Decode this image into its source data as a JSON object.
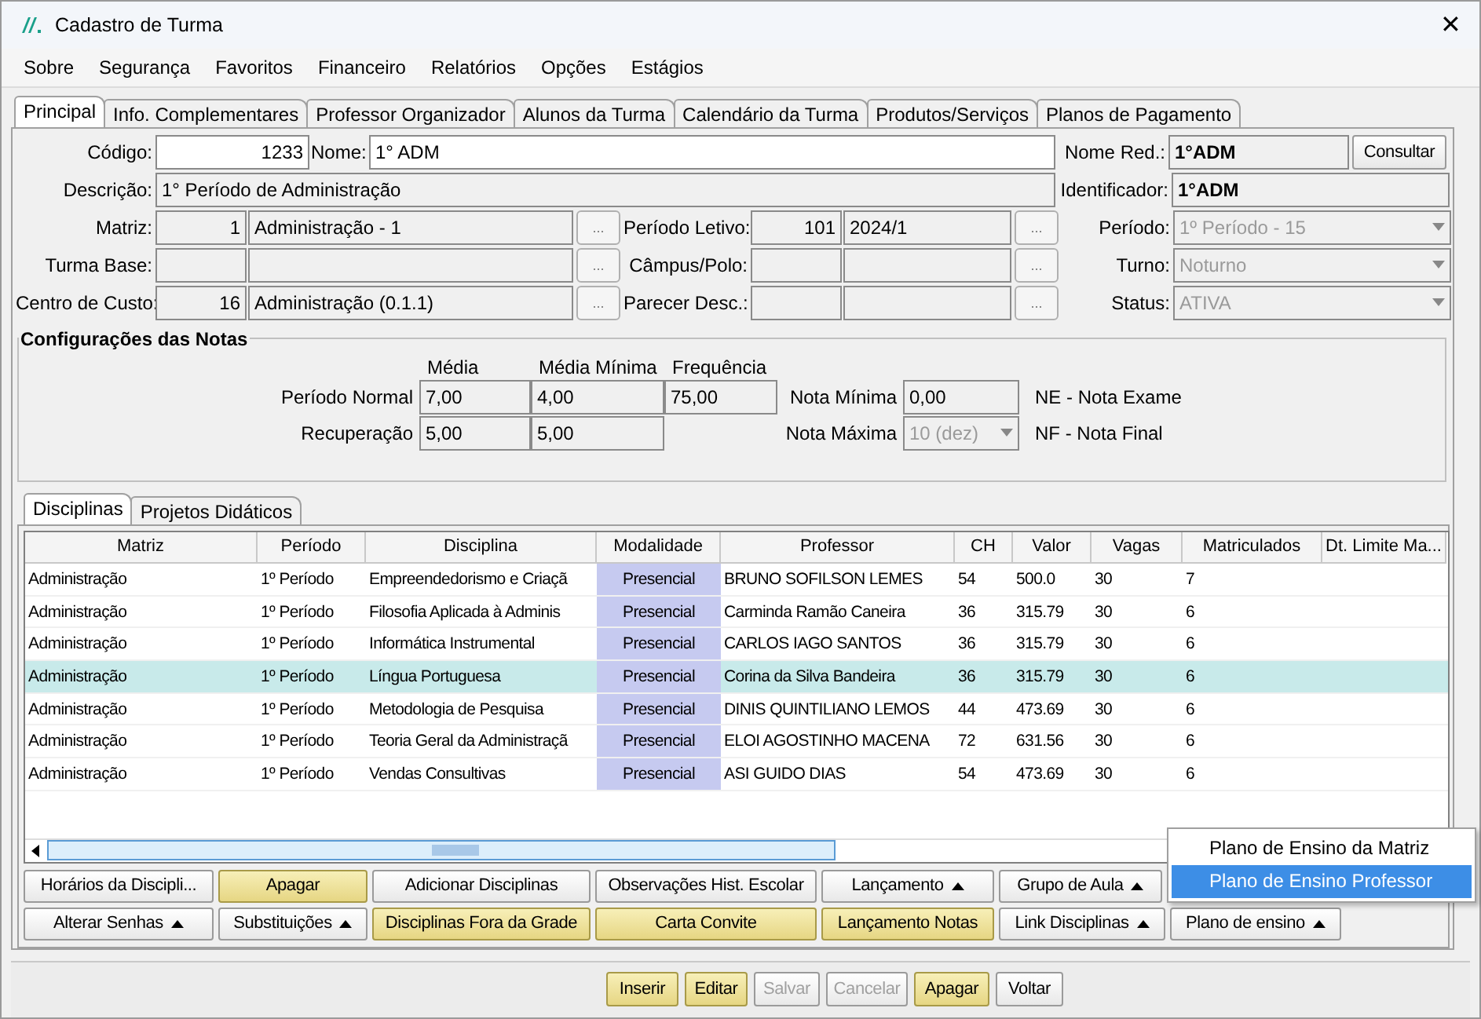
{
  "window": {
    "title": "Cadastro de Turma",
    "close": "✕"
  },
  "menu": [
    "Sobre",
    "Segurança",
    "Favoritos",
    "Financeiro",
    "Relatórios",
    "Opções",
    "Estágios"
  ],
  "tabs": [
    {
      "label": "Principal",
      "selected": true
    },
    {
      "label": "Info. Complementares",
      "selected": false
    },
    {
      "label": "Professor Organizador",
      "selected": false
    },
    {
      "label": "Alunos da Turma",
      "selected": false
    },
    {
      "label": "Calendário da Turma",
      "selected": false
    },
    {
      "label": "Produtos/Serviços",
      "selected": false
    },
    {
      "label": "Planos de Pagamento",
      "selected": false
    }
  ],
  "form": {
    "codigo": {
      "label": "Código:",
      "value": "1233"
    },
    "nome": {
      "label": "Nome:",
      "value": "1° ADM"
    },
    "nome_red": {
      "label": "Nome Red.:",
      "value": "1°ADM"
    },
    "consultar": "Consultar",
    "descricao": {
      "label": "Descrição:",
      "value": "1° Período de Administração"
    },
    "identificador": {
      "label": "Identificador:",
      "value": "1°ADM"
    },
    "matriz": {
      "label": "Matriz:",
      "code": "1",
      "name": "Administração - 1",
      "button": "..."
    },
    "periodo_letivo": {
      "label": "Período Letivo:",
      "code": "101",
      "name": "2024/1",
      "button": "..."
    },
    "periodo": {
      "label": "Período:",
      "value": "1º Período - 15",
      "disabled": true
    },
    "turma_base": {
      "label": "Turma Base:",
      "button": "..."
    },
    "campus_polo": {
      "label": "Câmpus/Polo:",
      "button": "..."
    },
    "turno": {
      "label": "Turno:",
      "value": "Noturno",
      "disabled": true
    },
    "centro_custo": {
      "label": "Centro de Custo:",
      "code": "16",
      "name": "Administração (0.1.1)",
      "button": "..."
    },
    "parecer_desc": {
      "label": "Parecer Desc.:",
      "button": "..."
    },
    "status": {
      "label": "Status:",
      "value": "ATIVA",
      "disabled": true
    }
  },
  "notas": {
    "title": "Configurações das Notas",
    "headers": [
      "Média",
      "Média Mínima",
      "Frequência"
    ],
    "rows": [
      {
        "label": "Período Normal",
        "values": [
          "7,00",
          "4,00",
          "75,00"
        ],
        "extra_label": "Nota Mínima",
        "extra_value": "0,00",
        "legend": "NE - Nota Exame"
      },
      {
        "label": "Recuperação",
        "values": [
          "5,00",
          "5,00"
        ],
        "extra_label": "Nota Máxima",
        "extra_value": "10 (dez)",
        "extra_disabled": true,
        "legend": "NF - Nota Final"
      }
    ]
  },
  "subtabs": [
    {
      "label": "Disciplinas",
      "selected": true
    },
    {
      "label": "Projetos Didáticos",
      "selected": false
    }
  ],
  "table": {
    "columns": [
      "Matriz",
      "Período",
      "Disciplina",
      "Modalidade",
      "Professor",
      "CH",
      "Valor",
      "Vagas",
      "Matriculados",
      "Dt. Limite Ma..."
    ],
    "rows": [
      {
        "selected": false,
        "cells": [
          "Administração",
          "1º Período",
          "Empreendedorismo e Criaçã",
          "Presencial",
          "BRUNO SOFILSON LEMES",
          "54",
          "500.0",
          "30",
          "7"
        ]
      },
      {
        "selected": false,
        "cells": [
          "Administração",
          "1º Período",
          "Filosofia Aplicada à Adminis",
          "Presencial",
          "Carminda Ramão Caneira",
          "36",
          "315.79",
          "30",
          "6"
        ]
      },
      {
        "selected": false,
        "cells": [
          "Administração",
          "1º Período",
          "Informática Instrumental",
          "Presencial",
          "CARLOS IAGO SANTOS",
          "36",
          "315.79",
          "30",
          "6"
        ]
      },
      {
        "selected": true,
        "cells": [
          "Administração",
          "1º Período",
          "Língua Portuguesa",
          "Presencial",
          "Corina da Silva Bandeira",
          "36",
          "315.79",
          "30",
          "6"
        ]
      },
      {
        "selected": false,
        "cells": [
          "Administração",
          "1º Período",
          "Metodologia de Pesquisa",
          "Presencial",
          "DINIS QUINTILIANO LEMOS",
          "44",
          "473.69",
          "30",
          "6"
        ]
      },
      {
        "selected": false,
        "cells": [
          "Administração",
          "1º Período",
          "Teoria Geral da Administraçã",
          "Presencial",
          "ELOI AGOSTINHO MACENA",
          "72",
          "631.56",
          "30",
          "6"
        ]
      },
      {
        "selected": false,
        "cells": [
          "Administração",
          "1º Período",
          "Vendas Consultivas",
          "Presencial",
          "ASI GUIDO DIAS",
          "54",
          "473.69",
          "30",
          "6"
        ]
      }
    ]
  },
  "action_rows": [
    [
      {
        "label": "Horários da Discipli...",
        "highlighted": false,
        "has_menu": false
      },
      {
        "label": "Apagar",
        "highlighted": true,
        "has_menu": false
      },
      {
        "label": "Adicionar Disciplinas",
        "highlighted": false,
        "has_menu": false
      },
      {
        "label": "Observações Hist. Escolar",
        "highlighted": false,
        "has_menu": false
      },
      {
        "label": "Lançamento",
        "highlighted": false,
        "has_menu": true
      },
      {
        "label": "Grupo de Aula",
        "highlighted": false,
        "has_menu": true
      }
    ],
    [
      {
        "label": "Alterar Senhas",
        "highlighted": false,
        "has_menu": true
      },
      {
        "label": "Substituições",
        "highlighted": false,
        "has_menu": true
      },
      {
        "label": "Disciplinas Fora da Grade",
        "highlighted": true,
        "has_menu": false
      },
      {
        "label": "Carta Convite",
        "highlighted": true,
        "has_menu": false
      },
      {
        "label": "Lançamento Notas",
        "highlighted": true,
        "has_menu": false
      },
      {
        "label": "Link Disciplinas",
        "highlighted": false,
        "has_menu": true
      },
      {
        "label": "Plano de ensino",
        "highlighted": false,
        "has_menu": true
      }
    ]
  ],
  "popup_menu": [
    {
      "label": "Plano de Ensino da Matriz",
      "selected": false
    },
    {
      "label": "Plano de Ensino Professor",
      "selected": true
    }
  ],
  "footer_buttons": [
    {
      "label": "Inserir",
      "highlighted": true,
      "disabled": false
    },
    {
      "label": "Editar",
      "highlighted": true,
      "disabled": false
    },
    {
      "label": "Salvar",
      "highlighted": false,
      "disabled": true
    },
    {
      "label": "Cancelar",
      "highlighted": false,
      "disabled": true
    },
    {
      "label": "Apagar",
      "highlighted": true,
      "disabled": false
    },
    {
      "label": "Voltar",
      "highlighted": false,
      "disabled": false
    }
  ]
}
